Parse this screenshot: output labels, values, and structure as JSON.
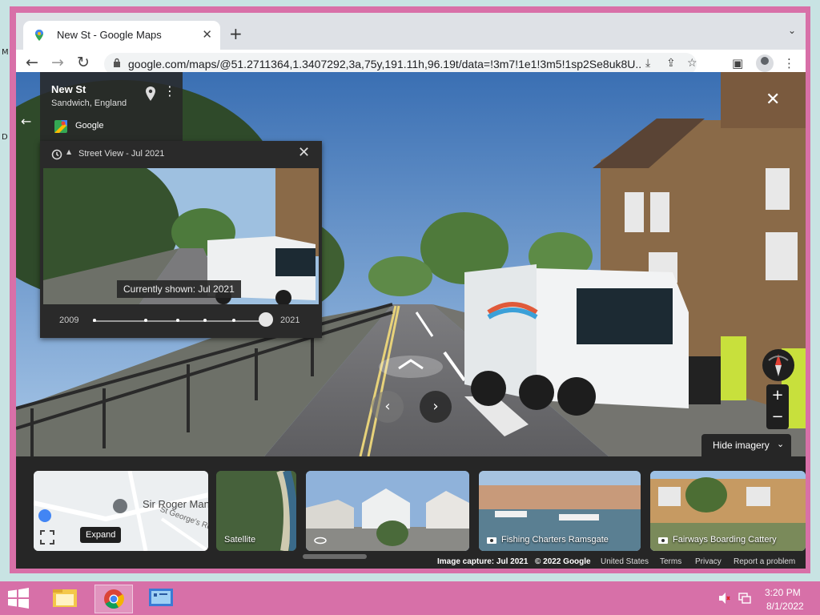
{
  "desktop": {
    "glyph_m": "M",
    "glyph_d": "D"
  },
  "window": {
    "minimize": "—",
    "maximize": "☐",
    "close": "✕"
  },
  "tab": {
    "title": "New St - Google Maps",
    "close": "✕",
    "new_tab": "+",
    "tab_search": "⌄"
  },
  "toolbar": {
    "url": "google.com/maps/@51.2711364,1.3407292,3a,75y,191.11h,96.19t/data=!3m7!1e1!3m5!1sp2Se8uk8U...",
    "back": "←",
    "forward": "→",
    "reload": "↻",
    "menu": "⋮"
  },
  "place": {
    "name": "New St",
    "subtitle": "Sandwich, England",
    "provider": "Google"
  },
  "time_machine": {
    "title": "Street View - Jul 2021",
    "tooltip": "Currently shown: Jul 2021",
    "start_year": "2009",
    "end_year": "2021",
    "position": 1.0
  },
  "controls": {
    "hide_imagery": "Hide imagery",
    "zoom_in": "+",
    "zoom_out": "−"
  },
  "cards": [
    {
      "label": "Sir Roger Manwood's S",
      "label2": "St George's Rd",
      "tooltip": "Expand"
    },
    {
      "label": "Satellite"
    },
    {
      "label": ""
    },
    {
      "label": "Fishing Charters Ramsgate"
    },
    {
      "label": "Fairways Boarding Cattery"
    }
  ],
  "footer": {
    "capture": "Image capture: Jul 2021",
    "copyright": "© 2022 Google",
    "country": "United States",
    "terms": "Terms",
    "privacy": "Privacy",
    "report": "Report a problem"
  },
  "taskbar": {
    "time": "3:20 PM",
    "date": "8/1/2022"
  },
  "colors": {
    "frame": "#d870a8",
    "desktop": "#c8e3e3",
    "panel": "#2a2a2a"
  }
}
